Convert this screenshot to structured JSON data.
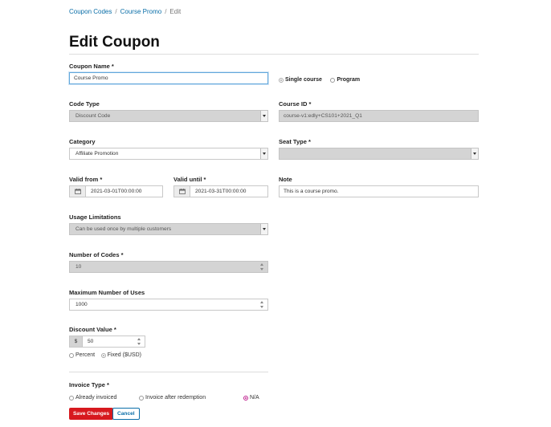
{
  "breadcrumb": {
    "items": [
      "Coupon Codes",
      "Course Promo"
    ],
    "current": "Edit",
    "separator": "/"
  },
  "page_title": "Edit Coupon",
  "fields": {
    "coupon_name": {
      "label": "Coupon Name *",
      "value": "Course Promo"
    },
    "scope": {
      "options": [
        "Single course",
        "Program"
      ],
      "selected": "Single course"
    },
    "code_type": {
      "label": "Code Type",
      "value": "Discount Code"
    },
    "course_id": {
      "label": "Course ID *",
      "value": "course-v1:edly+CS101+2021_Q1"
    },
    "category": {
      "label": "Category",
      "value": "Affiliate Promotion"
    },
    "seat_type": {
      "label": "Seat Type *",
      "value": ""
    },
    "valid_from": {
      "label": "Valid from *",
      "value": "2021-03-01T00:00:00"
    },
    "valid_until": {
      "label": "Valid until *",
      "value": "2021-03-31T00:00:00"
    },
    "note": {
      "label": "Note",
      "value": "This is a course promo."
    },
    "usage_limitations": {
      "label": "Usage Limitations",
      "value": "Can be used once by multiple customers"
    },
    "number_of_codes": {
      "label": "Number of Codes *",
      "value": "10"
    },
    "max_uses": {
      "label": "Maximum Number of Uses",
      "value": "1000"
    },
    "discount_value": {
      "label": "Discount Value *",
      "prefix": "$",
      "value": "50",
      "options": [
        "Percent",
        "Fixed ($USD)"
      ],
      "selected": "Fixed ($USD)"
    },
    "invoice_type": {
      "label": "Invoice Type *",
      "options": [
        "Already invoiced",
        "Invoice after redemption",
        "N/A"
      ],
      "selected": "N/A"
    }
  },
  "actions": {
    "save_label": "Save Changes",
    "cancel_label": "Cancel"
  },
  "colors": {
    "link": "#0a6ea8",
    "primary": "#d7191e",
    "radio_selected": "#c0228f",
    "disabled_bg": "#d4d4d4"
  }
}
